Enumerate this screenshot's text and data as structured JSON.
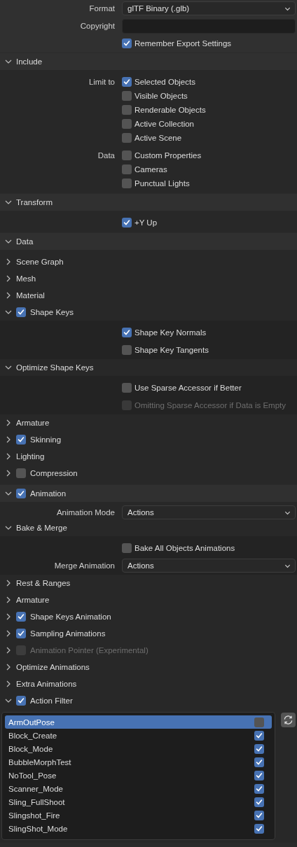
{
  "settings": [
    {
      "kind": "dropdown",
      "label": "Format",
      "value": "glTF Binary (.glb)"
    },
    {
      "kind": "text",
      "label": "Copyright"
    },
    {
      "kind": "checks",
      "options": [
        {
          "text": "Remember Export Settings",
          "checked": true,
          "disabled": false
        }
      ]
    },
    {
      "kind": "panel",
      "title": "Include",
      "expanded": true,
      "disabled": false,
      "items": [
        {
          "kind": "checks",
          "label": "Limit to",
          "options": [
            {
              "text": "Selected Objects",
              "checked": true,
              "disabled": false
            },
            {
              "text": "Visible Objects",
              "checked": false,
              "disabled": false
            },
            {
              "text": "Renderable Objects",
              "checked": false,
              "disabled": false
            },
            {
              "text": "Active Collection",
              "checked": false,
              "disabled": false
            },
            {
              "text": "Active Scene",
              "checked": false,
              "disabled": false
            }
          ]
        },
        {
          "kind": "checks",
          "label": "Data",
          "options": [
            {
              "text": "Custom Properties",
              "checked": false,
              "disabled": false
            },
            {
              "text": "Cameras",
              "checked": false,
              "disabled": false
            },
            {
              "text": "Punctual Lights",
              "checked": false,
              "disabled": false
            }
          ]
        }
      ]
    },
    {
      "kind": "panel",
      "title": "Transform",
      "expanded": true,
      "disabled": false,
      "items": [
        {
          "kind": "checks",
          "options": [
            {
              "text": "+Y Up",
              "checked": true,
              "disabled": false
            }
          ]
        }
      ]
    },
    {
      "kind": "panel",
      "title": "Data",
      "expanded": true,
      "disabled": false,
      "items": [
        {
          "kind": "panel",
          "title": "Scene Graph",
          "expanded": false,
          "disabled": false
        },
        {
          "kind": "panel",
          "title": "Mesh",
          "expanded": false,
          "disabled": false
        },
        {
          "kind": "panel",
          "title": "Material",
          "expanded": false,
          "disabled": false
        },
        {
          "kind": "panel",
          "title": "Shape Keys",
          "expanded": true,
          "checked": true,
          "disabled": false,
          "items": [
            {
              "kind": "checks",
              "options": [
                {
                  "text": "Shape Key Normals",
                  "checked": true,
                  "disabled": false
                }
              ]
            },
            {
              "kind": "checks",
              "options": [
                {
                  "text": "Shape Key Tangents",
                  "checked": false,
                  "disabled": false
                }
              ]
            }
          ]
        },
        {
          "kind": "panel",
          "title": "Optimize Shape Keys",
          "expanded": true,
          "disabled": false,
          "items": [
            {
              "kind": "checks",
              "options": [
                {
                  "text": "Use Sparse Accessor if Better",
                  "checked": false,
                  "disabled": false
                }
              ]
            },
            {
              "kind": "checks",
              "options": [
                {
                  "text": "Omitting Sparse Accessor if Data is Empty",
                  "checked": false,
                  "disabled": true
                }
              ]
            }
          ]
        },
        {
          "kind": "panel",
          "title": "Armature",
          "expanded": false,
          "disabled": false
        },
        {
          "kind": "panel",
          "title": "Skinning",
          "expanded": false,
          "checked": true,
          "disabled": false
        },
        {
          "kind": "panel",
          "title": "Lighting",
          "expanded": false,
          "disabled": false
        },
        {
          "kind": "panel",
          "title": "Compression",
          "expanded": false,
          "checked": false,
          "disabled": false
        }
      ]
    },
    {
      "kind": "panel",
      "title": "Animation",
      "expanded": true,
      "checked": true,
      "disabled": false,
      "items": [
        {
          "kind": "dropdown",
          "label": "Animation Mode",
          "value": "Actions"
        },
        {
          "kind": "panel",
          "title": "Bake & Merge",
          "expanded": true,
          "disabled": false,
          "items": [
            {
              "kind": "checks",
              "options": [
                {
                  "text": "Bake All Objects Animations",
                  "checked": false,
                  "disabled": false
                }
              ]
            },
            {
              "kind": "dropdown",
              "label": "Merge Animation",
              "value": "Actions"
            }
          ]
        },
        {
          "kind": "panel",
          "title": "Rest & Ranges",
          "expanded": false,
          "disabled": false
        },
        {
          "kind": "panel",
          "title": "Armature",
          "expanded": false,
          "disabled": false
        },
        {
          "kind": "panel",
          "title": "Shape Keys Animation",
          "expanded": false,
          "checked": true,
          "disabled": false
        },
        {
          "kind": "panel",
          "title": "Sampling Animations",
          "expanded": false,
          "checked": true,
          "disabled": false
        },
        {
          "kind": "panel",
          "title": "Animation Pointer (Experimental)",
          "expanded": false,
          "checked": false,
          "disabled": true
        },
        {
          "kind": "panel",
          "title": "Optimize Animations",
          "expanded": false,
          "disabled": false
        },
        {
          "kind": "panel",
          "title": "Extra Animations",
          "expanded": false,
          "disabled": false
        },
        {
          "kind": "panel",
          "title": "Action Filter",
          "expanded": true,
          "checked": true,
          "disabled": false,
          "items": [
            {
              "kind": "list",
              "rows": [
                {
                  "name": "ArmOutPose",
                  "selected": true,
                  "checked": false
                },
                {
                  "name": "Block_Create",
                  "selected": false,
                  "checked": true
                },
                {
                  "name": "Block_Mode",
                  "selected": false,
                  "checked": true
                },
                {
                  "name": "BubbleMorphTest",
                  "selected": false,
                  "checked": true
                },
                {
                  "name": "NoTool_Pose",
                  "selected": false,
                  "checked": true
                },
                {
                  "name": "Scanner_Mode",
                  "selected": false,
                  "checked": true
                },
                {
                  "name": "Sling_FullShoot",
                  "selected": false,
                  "checked": true
                },
                {
                  "name": "Slingshot_Fire",
                  "selected": false,
                  "checked": true
                },
                {
                  "name": "SlingShot_Mode",
                  "selected": false,
                  "checked": true
                }
              ]
            }
          ]
        }
      ]
    }
  ]
}
